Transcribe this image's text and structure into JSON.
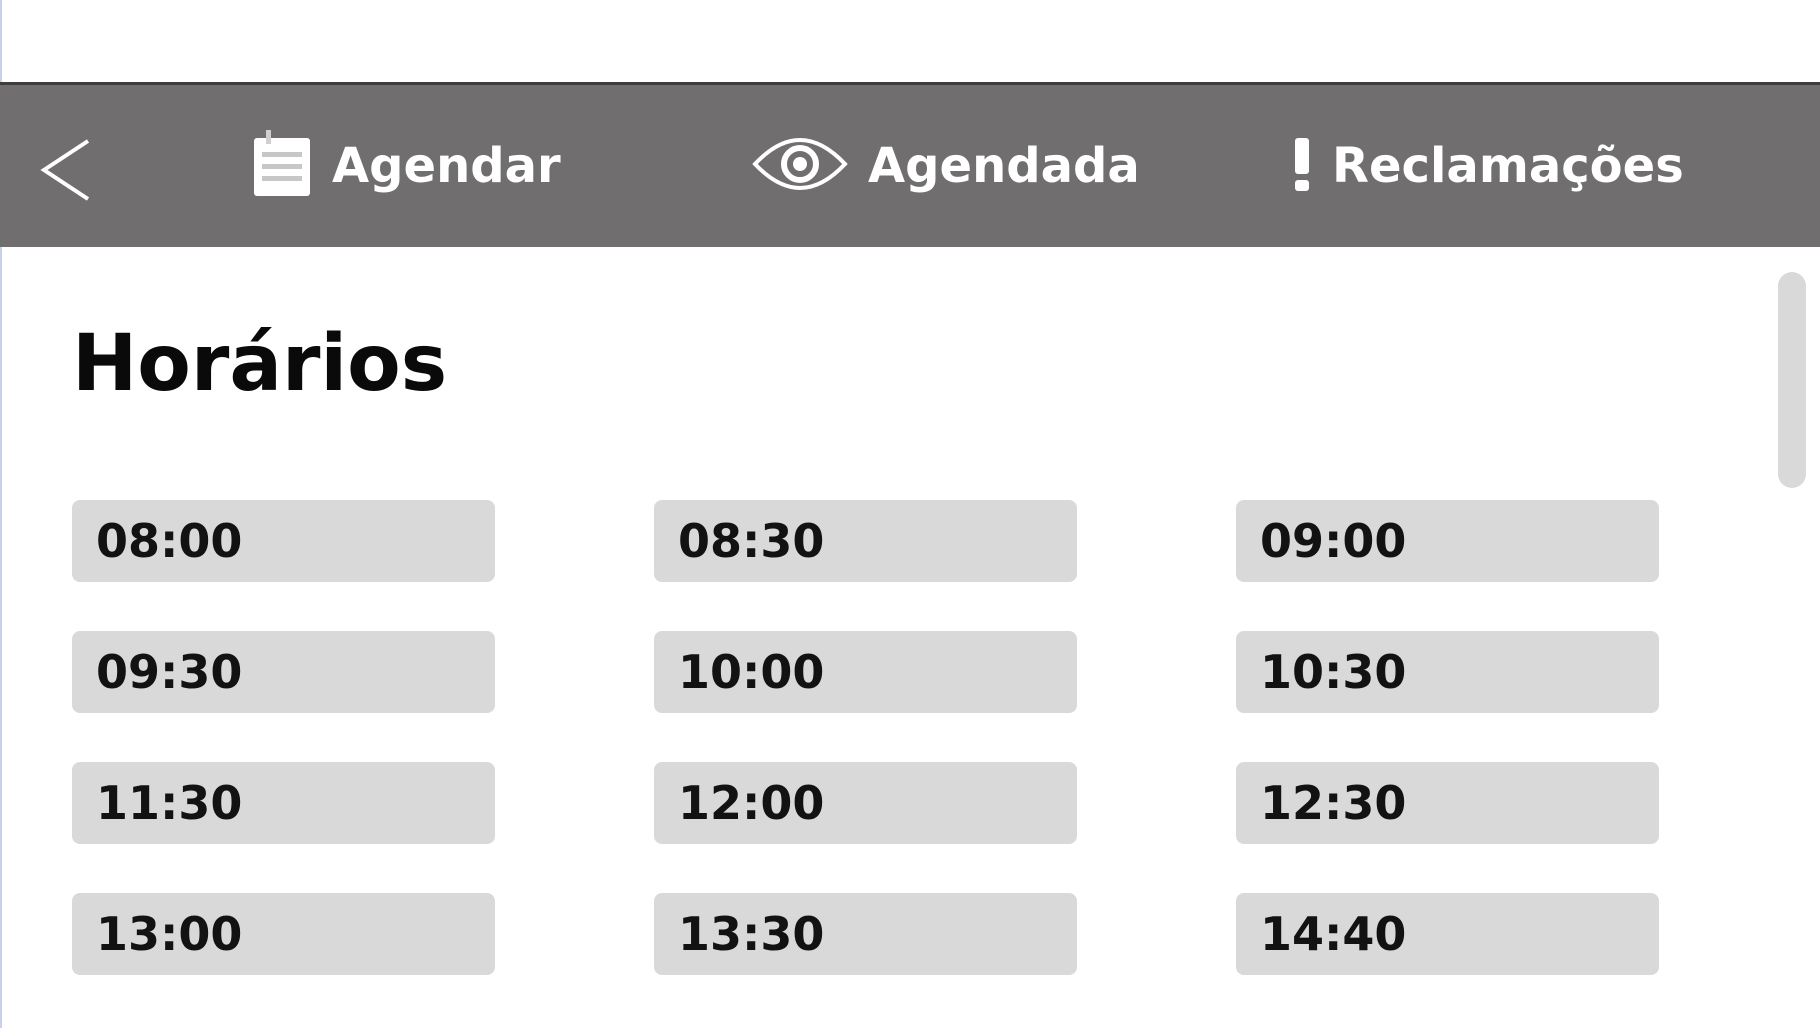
{
  "navigation": {
    "back_icon": "chevron-left-icon",
    "items": [
      {
        "id": "agendar",
        "icon": "notepad-icon",
        "label": "Agendar"
      },
      {
        "id": "agendada",
        "icon": "eye-icon",
        "label": "Agendada"
      },
      {
        "id": "reclamacoes",
        "icon": "exclamation-icon",
        "label": "Reclamações"
      }
    ]
  },
  "main": {
    "title": "Horários",
    "slots": [
      "08:00",
      "08:30",
      "09:00",
      "09:30",
      "10:00",
      "10:30",
      "11:30",
      "12:00",
      "12:30",
      "13:00",
      "13:30",
      "14:40"
    ]
  },
  "colors": {
    "nav_background": "#706e6f",
    "nav_text": "#ffffff",
    "slot_background": "#d9d9d9",
    "title_text": "#0a0a0a",
    "scrollbar": "#d9d9d9"
  }
}
